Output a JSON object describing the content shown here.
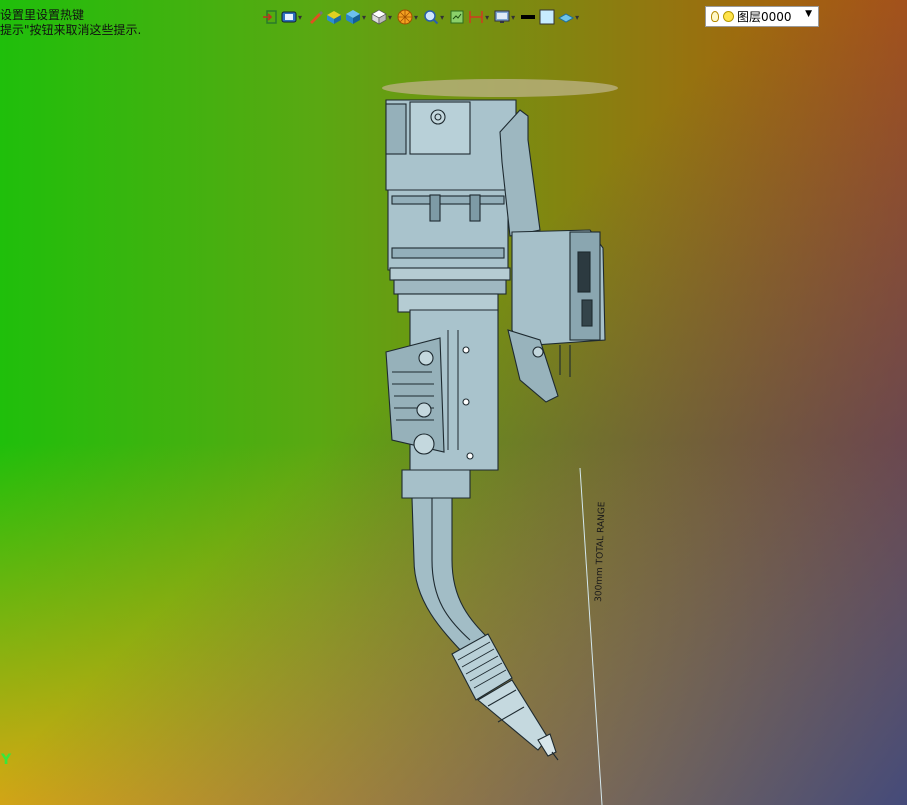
{
  "hint": {
    "line1": "设置里设置热键",
    "line2": "提示\"按钮来取消这些提示."
  },
  "toolbar": {
    "icons": [
      "exit-icon",
      "render-icon",
      "paint-icon",
      "texture-icon",
      "cube-icon",
      "view-cube-icon",
      "material-icon",
      "zoom-icon",
      "layer-view-icon",
      "dimension-icon",
      "display-icon",
      "color-swatch-icon",
      "fill-swatch-icon",
      "plane-icon"
    ]
  },
  "layer": {
    "name": "图层0000"
  },
  "viewport": {
    "axis_label": "Y",
    "dimension_text": "300mm TOTAL RANGE"
  },
  "colors": {
    "model_fill": "#a9c3cc",
    "model_stroke": "#1e2a30",
    "accent_green": "#39e83a"
  }
}
